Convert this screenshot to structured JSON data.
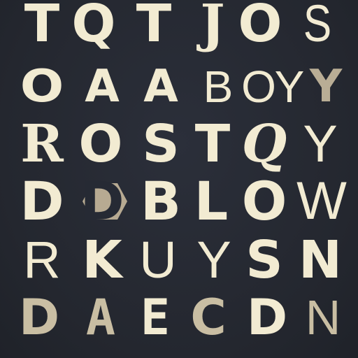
{
  "rows": [
    [
      "T",
      "Q",
      "T",
      "J",
      "O",
      "S"
    ],
    [
      "O",
      "A",
      "A",
      "B",
      "O",
      "Y",
      "Y"
    ],
    [
      "R",
      "O",
      "S",
      "T",
      "Q",
      "Y"
    ],
    [
      "D",
      "D",
      "B",
      "L",
      "O",
      "W"
    ],
    [
      "R",
      "K",
      "U",
      "Y",
      "S",
      "N"
    ],
    [
      "D",
      "A",
      "E",
      "C",
      "D",
      "N"
    ]
  ],
  "colors": {
    "background": "#262a34",
    "glyph": "#f2ebd2",
    "muted": "#c9bea3",
    "badge": "#b7aa92"
  },
  "icons": {
    "diamond_badge": "diamond-shape-icon"
  }
}
